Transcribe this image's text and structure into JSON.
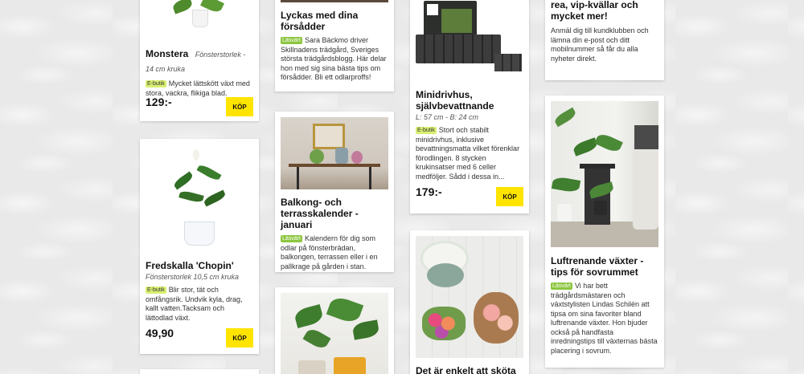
{
  "cards": {
    "monstera": {
      "title": "Monstera",
      "size": "Fönsterstorlek - 14 cm kruka",
      "badge": "E-butik",
      "desc": "Mycket lättskött växt med stora, vackra, flikiga blad.",
      "price": "129:-",
      "buy_label": "KÖP"
    },
    "fredskalla": {
      "title": "Fredskalla 'Chopin'",
      "size": "Fönsterstorlek 10,5 cm kruka",
      "badge": "E-butik",
      "desc": "Blir stor, tät och omfångsrik. Undvik kyla, drag, kallt vatten.Tacksam och lättodlad växt.",
      "price": "49,90",
      "buy_label": "KÖP"
    },
    "lyckas": {
      "title": "Lyckas med dina försådder",
      "badge": "Läsvärt",
      "desc": "Sara Bäckmo driver Skillnadens trädgård, Sveriges största trädgårdsblogg. Här delar hon med sig sina bästa tips om försådder. Bli ett odlarproffs!"
    },
    "balkong": {
      "title": "Balkong- och terrasskalender - januari",
      "badge": "Läsvärt",
      "desc": "Kalendern för dig som odlar på fönsterbrädan, balkongen, terrassen eller i en pallkrage på gården i stan."
    },
    "minidrivhus": {
      "title": "Minidrivhus, självbevattnande",
      "size": "L: 57 cm - B: 24 cm",
      "badge": "E-butik",
      "desc": "Stort och stabilt minidrivhus, inklusive bevattningsmatta vilket förenklar förodlingen. 8 stycken krukinsatser med 6 celler medföljer. Sådd i dessa in...",
      "price": "179:-",
      "buy_label": "KÖP"
    },
    "enkelt": {
      "title": "Det är enkelt att sköta"
    },
    "klubb": {
      "title": "Missa inte utskick om rea, vip-kvällar och mycket mer!",
      "desc": "Anmäl dig till kundklubben och lämna din e-post och ditt mobilnummer så får du alla nyheter direkt."
    },
    "luftrenande": {
      "title": "Luftrenande växter - tips för sovrummet",
      "badge": "Läsvärt",
      "desc": "Vi har bett trädgårdsmästaren och växtstylisten Lindas Schilén att tipsa om sina favoriter bland luftrenande växter. Hon bjuder också på handfasta inredningstips till växternas bästa placering i sovrum."
    }
  },
  "colors": {
    "buy": "#ffe400",
    "badge_ebutik": "#d8ef72",
    "badge_lasvart": "#8cc63f"
  }
}
